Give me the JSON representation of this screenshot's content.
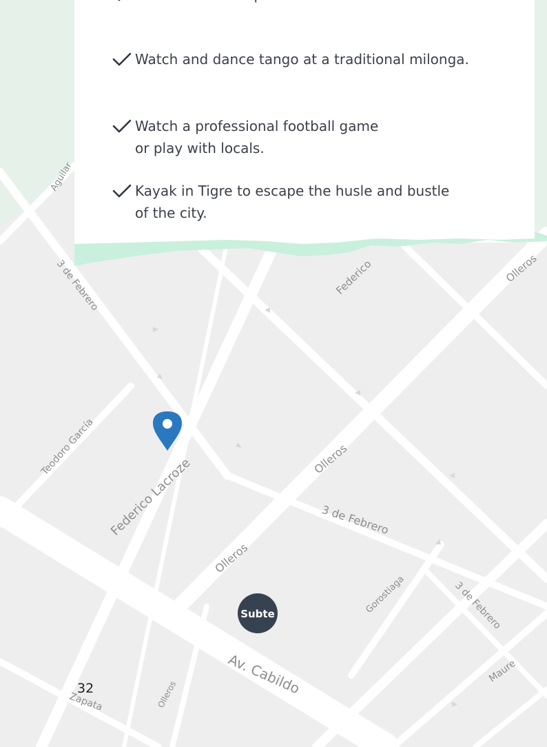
{
  "map": {
    "streets": {
      "aguilar": "Aguilar",
      "febrero_top": "3 de Febrero",
      "federico_top": "Federico",
      "olleros_top": "Olleros",
      "teodoro_garcia": "Teodoro García",
      "federico_lacroze": "Federico Lacroze",
      "olleros_mid": "Olleros",
      "febrero_mid": "3 de Febrero",
      "olleros_lower": "Olleros",
      "gorostiaga": "Gorostiaga",
      "febrero_right": "3 de Febrero",
      "cabildo": "Av. Cabildo",
      "maure": "Maure",
      "olleros_bottom": "Olleros",
      "zapata": "Zapata"
    },
    "subte_badge": "Subte",
    "colors": {
      "pin": "#2a78c0",
      "subte_badge": "#36424f",
      "torn_edge": "#c9f0dc"
    }
  },
  "activities": [
    {
      "icon": "checkmark-icon",
      "text": "See a street or a performance on Corrientes Avenue"
    },
    {
      "icon": "checkmark-icon",
      "text": "Watch and dance tango at a traditional milonga."
    },
    {
      "icon": "checkmark-icon",
      "text": "Watch a professional football game\nor play with locals."
    },
    {
      "icon": "checkmark-icon",
      "text": "Kayak in Tigre to escape the husle and bustle\nof the city."
    }
  ],
  "page_number": "32"
}
